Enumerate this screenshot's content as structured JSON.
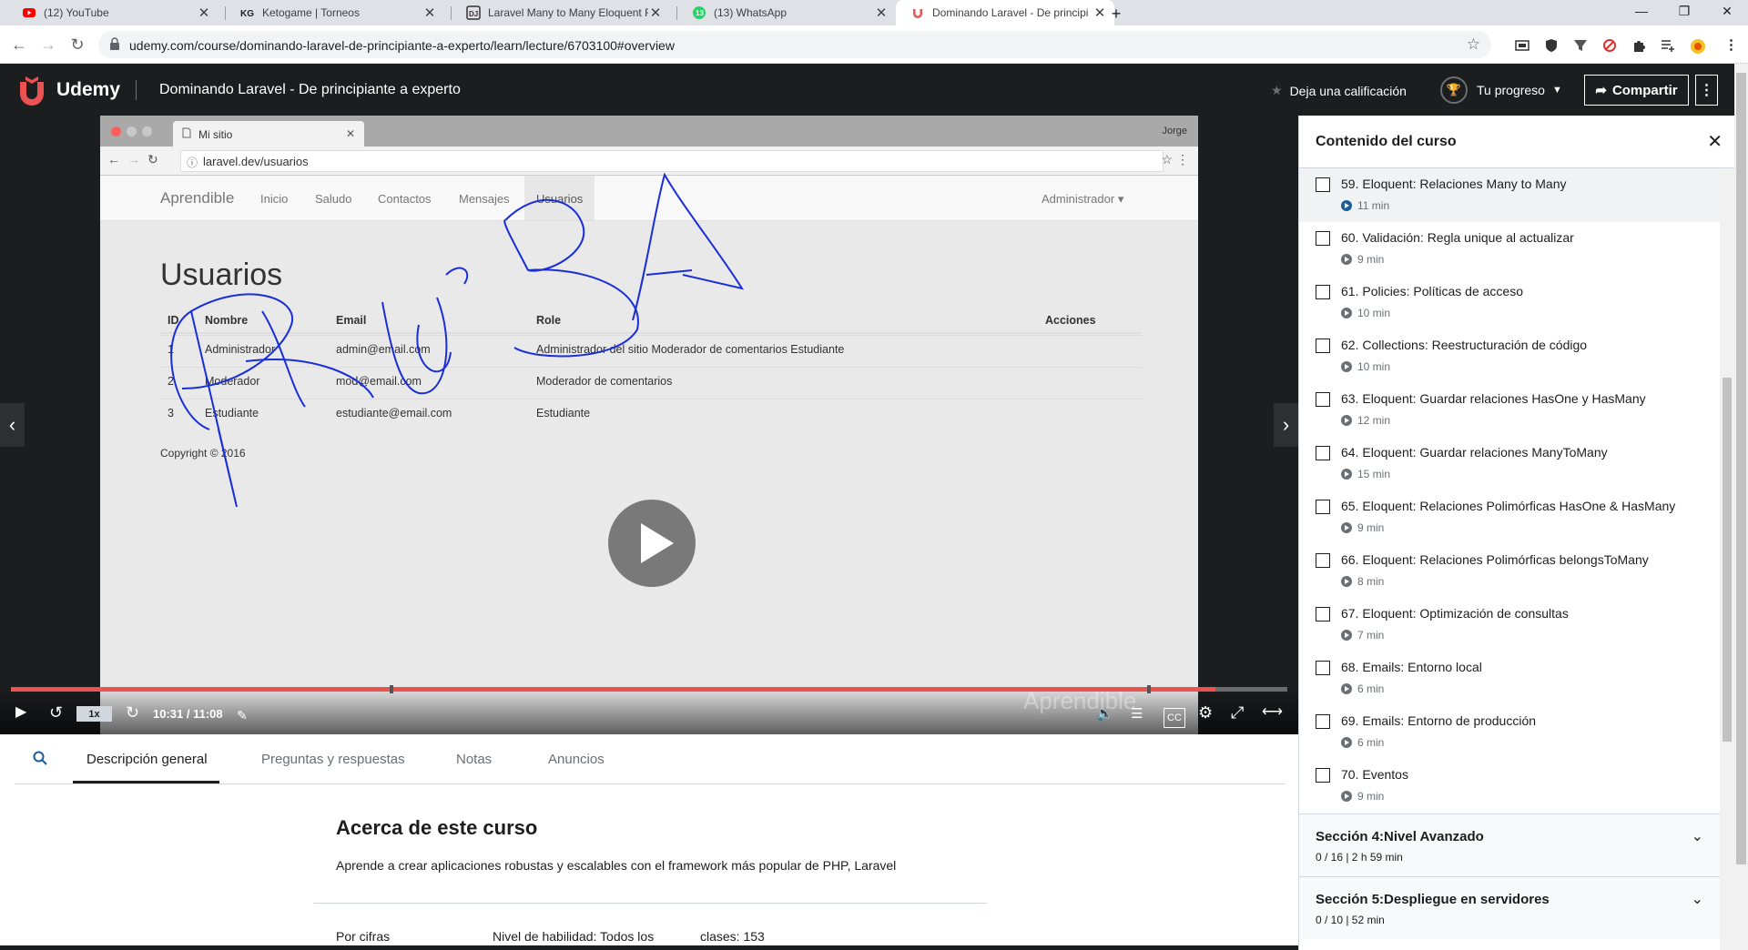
{
  "browser": {
    "tabs": [
      {
        "title": "(12) YouTube",
        "icon": "youtube-icon"
      },
      {
        "title": "Ketogame | Torneos",
        "icon": "ketogame-icon"
      },
      {
        "title": "Laravel Many to Many Eloquent F",
        "icon": "laravel-site-icon"
      },
      {
        "title": "(13) WhatsApp",
        "icon": "whatsapp-icon"
      },
      {
        "title": "Dominando Laravel - De principi",
        "icon": "udemy-icon"
      }
    ],
    "url": "udemy.com/course/dominando-laravel-de-principiante-a-experto/learn/lecture/6703100#overview"
  },
  "header": {
    "logo": "Udemy",
    "course_title": "Dominando Laravel - De principiante a experto",
    "rate_label": "Deja una calificación",
    "progress_label": "Tu progreso",
    "share_label": "Compartir"
  },
  "video": {
    "browser_tab": "Mi sitio",
    "browser_user": "Jorge",
    "url": "laravel.dev/usuarios",
    "brand": "Aprendible",
    "nav": [
      "Inicio",
      "Saludo",
      "Contactos",
      "Mensajes",
      "Usuarios"
    ],
    "admin_menu": "Administrador",
    "heading": "Usuarios",
    "columns": [
      "ID",
      "Nombre",
      "Email",
      "Role",
      "Acciones"
    ],
    "rows": [
      {
        "id": "1",
        "name": "Administrador",
        "email": "admin@email.com",
        "role": "Administrador del sitio Moderador de comentarios Estudiante"
      },
      {
        "id": "2",
        "name": "Moderador",
        "email": "mod@email.com",
        "role": "Moderador de comentarios"
      },
      {
        "id": "3",
        "name": "Estudiante",
        "email": "estudiante@email.com",
        "role": "Estudiante"
      }
    ],
    "copyright": "Copyright © 2016",
    "watermark": "Aprendible",
    "speed": "1x",
    "time": "10:31 / 11:08",
    "progress_fraction": 0.944
  },
  "below": {
    "tabs": [
      "Descripción general",
      "Preguntas y respuestas",
      "Notas",
      "Anuncios"
    ],
    "about_title": "Acerca de este curso",
    "about_desc": "Aprende a crear aplicaciones robustas y escalables con el framework más popular de PHP, Laravel",
    "figures_label": "Por cifras",
    "skill_level": "Nivel de habilidad: Todos los",
    "lectures": "clases: 153"
  },
  "sidebar": {
    "title": "Contenido del curso",
    "lectures": [
      {
        "title": "59. Eloquent: Relaciones Many to Many",
        "duration": "11 min"
      },
      {
        "title": "60. Validación: Regla unique al actualizar",
        "duration": "9 min"
      },
      {
        "title": "61. Policies: Políticas de acceso",
        "duration": "10 min"
      },
      {
        "title": "62. Collections: Reestructuración de código",
        "duration": "10 min"
      },
      {
        "title": "63. Eloquent: Guardar relaciones HasOne y HasMany",
        "duration": "12 min"
      },
      {
        "title": "64. Eloquent: Guardar relaciones ManyToMany",
        "duration": "15 min"
      },
      {
        "title": "65. Eloquent: Relaciones Polimórficas HasOne & HasMany",
        "duration": "9 min"
      },
      {
        "title": "66. Eloquent: Relaciones Polimórficas belongsToMany",
        "duration": "8 min"
      },
      {
        "title": "67. Eloquent: Optimización de consultas",
        "duration": "7 min"
      },
      {
        "title": "68. Emails: Entorno local",
        "duration": "6 min"
      },
      {
        "title": "69. Emails: Entorno de producción",
        "duration": "6 min"
      },
      {
        "title": "70. Eventos",
        "duration": "9 min"
      }
    ],
    "sections": [
      {
        "name": "Sección 4:Nivel Avanzado",
        "meta": "0 / 16 | 2 h 59 min"
      },
      {
        "name": "Sección 5:Despliegue en servidores",
        "meta": "0 / 10 | 52 min"
      }
    ]
  },
  "colors": {
    "accent": "#ec5252",
    "udemy": "#a435f0",
    "dark": "#1c1d1f"
  }
}
